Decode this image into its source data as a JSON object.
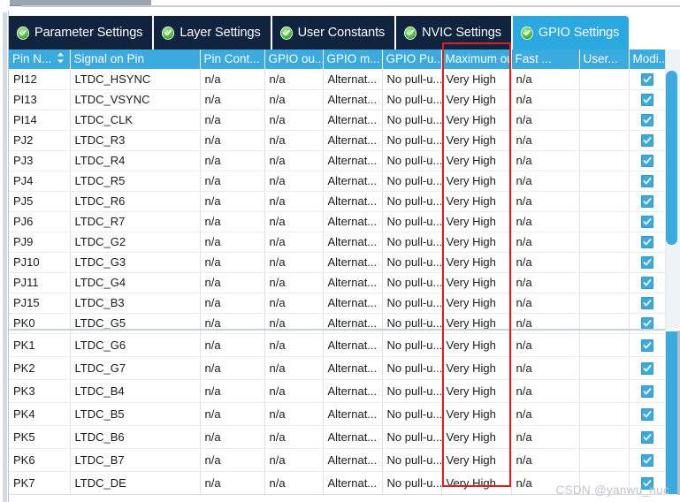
{
  "window": {
    "title": "GPIO Settings",
    "watermark": "CSDN @yanwu_nuc",
    "accent_color": "#29a9e0",
    "tab_inactive_color": "#10233f",
    "header_color": "#3babdf",
    "highlight_color": "#e21c1c"
  },
  "tabs": [
    {
      "label": "Parameter Settings",
      "icon": "green-check-icon",
      "active": false
    },
    {
      "label": "Layer Settings",
      "icon": "green-check-icon",
      "active": false
    },
    {
      "label": "User Constants",
      "icon": "green-check-icon",
      "active": false
    },
    {
      "label": "NVIC Settings",
      "icon": "green-check-icon",
      "active": false
    },
    {
      "label": "GPIO Settings",
      "icon": "green-check-icon",
      "active": true
    }
  ],
  "table": {
    "columns": [
      {
        "key": "pin_name",
        "label": "Pin N...",
        "sort_indicator": "↕",
        "sorted": true
      },
      {
        "key": "signal_on_pin",
        "label": "Signal on Pin",
        "align": "center"
      },
      {
        "key": "pin_context",
        "label": "Pin Cont..."
      },
      {
        "key": "gpio_output",
        "label": "GPIO ou..."
      },
      {
        "key": "gpio_mode",
        "label": "GPIO m..."
      },
      {
        "key": "gpio_pull",
        "label": "GPIO Pu..."
      },
      {
        "key": "max_output_speed",
        "label": "Maximum outp..."
      },
      {
        "key": "fast_mode",
        "label": "Fast ..."
      },
      {
        "key": "user_label",
        "label": "User..."
      },
      {
        "key": "modified",
        "label": "Modi..."
      }
    ],
    "rows": [
      {
        "pin_name": "PI12",
        "signal_on_pin": "LTDC_HSYNC",
        "pin_context": "n/a",
        "gpio_output": "n/a",
        "gpio_mode": "Alternat...",
        "gpio_pull": "No pull-u...",
        "max_output_speed": "Very High",
        "fast_mode": "n/a",
        "user_label": "",
        "modified": true
      },
      {
        "pin_name": "PI13",
        "signal_on_pin": "LTDC_VSYNC",
        "pin_context": "n/a",
        "gpio_output": "n/a",
        "gpio_mode": "Alternat...",
        "gpio_pull": "No pull-u...",
        "max_output_speed": "Very High",
        "fast_mode": "n/a",
        "user_label": "",
        "modified": true
      },
      {
        "pin_name": "PI14",
        "signal_on_pin": "LTDC_CLK",
        "pin_context": "n/a",
        "gpio_output": "n/a",
        "gpio_mode": "Alternat...",
        "gpio_pull": "No pull-u...",
        "max_output_speed": "Very High",
        "fast_mode": "n/a",
        "user_label": "",
        "modified": true
      },
      {
        "pin_name": "PJ2",
        "signal_on_pin": "LTDC_R3",
        "pin_context": "n/a",
        "gpio_output": "n/a",
        "gpio_mode": "Alternat...",
        "gpio_pull": "No pull-u...",
        "max_output_speed": "Very High",
        "fast_mode": "n/a",
        "user_label": "",
        "modified": true
      },
      {
        "pin_name": "PJ3",
        "signal_on_pin": "LTDC_R4",
        "pin_context": "n/a",
        "gpio_output": "n/a",
        "gpio_mode": "Alternat...",
        "gpio_pull": "No pull-u...",
        "max_output_speed": "Very High",
        "fast_mode": "n/a",
        "user_label": "",
        "modified": true
      },
      {
        "pin_name": "PJ4",
        "signal_on_pin": "LTDC_R5",
        "pin_context": "n/a",
        "gpio_output": "n/a",
        "gpio_mode": "Alternat...",
        "gpio_pull": "No pull-u...",
        "max_output_speed": "Very High",
        "fast_mode": "n/a",
        "user_label": "",
        "modified": true
      },
      {
        "pin_name": "PJ5",
        "signal_on_pin": "LTDC_R6",
        "pin_context": "n/a",
        "gpio_output": "n/a",
        "gpio_mode": "Alternat...",
        "gpio_pull": "No pull-u...",
        "max_output_speed": "Very High",
        "fast_mode": "n/a",
        "user_label": "",
        "modified": true
      },
      {
        "pin_name": "PJ6",
        "signal_on_pin": "LTDC_R7",
        "pin_context": "n/a",
        "gpio_output": "n/a",
        "gpio_mode": "Alternat...",
        "gpio_pull": "No pull-u...",
        "max_output_speed": "Very High",
        "fast_mode": "n/a",
        "user_label": "",
        "modified": true
      },
      {
        "pin_name": "PJ9",
        "signal_on_pin": "LTDC_G2",
        "pin_context": "n/a",
        "gpio_output": "n/a",
        "gpio_mode": "Alternat...",
        "gpio_pull": "No pull-u...",
        "max_output_speed": "Very High",
        "fast_mode": "n/a",
        "user_label": "",
        "modified": true
      },
      {
        "pin_name": "PJ10",
        "signal_on_pin": "LTDC_G3",
        "pin_context": "n/a",
        "gpio_output": "n/a",
        "gpio_mode": "Alternat...",
        "gpio_pull": "No pull-u...",
        "max_output_speed": "Very High",
        "fast_mode": "n/a",
        "user_label": "",
        "modified": true
      },
      {
        "pin_name": "PJ11",
        "signal_on_pin": "LTDC_G4",
        "pin_context": "n/a",
        "gpio_output": "n/a",
        "gpio_mode": "Alternat...",
        "gpio_pull": "No pull-u...",
        "max_output_speed": "Very High",
        "fast_mode": "n/a",
        "user_label": "",
        "modified": true
      },
      {
        "pin_name": "PJ15",
        "signal_on_pin": "LTDC_B3",
        "pin_context": "n/a",
        "gpio_output": "n/a",
        "gpio_mode": "Alternat...",
        "gpio_pull": "No pull-u...",
        "max_output_speed": "Very High",
        "fast_mode": "n/a",
        "user_label": "",
        "modified": true
      },
      {
        "pin_name": "PK0",
        "signal_on_pin": "LTDC_G5",
        "pin_context": "n/a",
        "gpio_output": "n/a",
        "gpio_mode": "Alternat...",
        "gpio_pull": "No pull-u...",
        "max_output_speed": "Very High",
        "fast_mode": "n/a",
        "user_label": "",
        "modified": true
      },
      {
        "pin_name": "PK1",
        "signal_on_pin": "LTDC_G6",
        "pin_context": "n/a",
        "gpio_output": "n/a",
        "gpio_mode": "Alternat...",
        "gpio_pull": "No pull-u...",
        "max_output_speed": "Very High",
        "fast_mode": "n/a",
        "user_label": "",
        "modified": true
      },
      {
        "pin_name": "PK2",
        "signal_on_pin": "LTDC_G7",
        "pin_context": "n/a",
        "gpio_output": "n/a",
        "gpio_mode": "Alternat...",
        "gpio_pull": "No pull-u...",
        "max_output_speed": "Very High",
        "fast_mode": "n/a",
        "user_label": "",
        "modified": true
      },
      {
        "pin_name": "PK3",
        "signal_on_pin": "LTDC_B4",
        "pin_context": "n/a",
        "gpio_output": "n/a",
        "gpio_mode": "Alternat...",
        "gpio_pull": "No pull-u...",
        "max_output_speed": "Very High",
        "fast_mode": "n/a",
        "user_label": "",
        "modified": true
      },
      {
        "pin_name": "PK4",
        "signal_on_pin": "LTDC_B5",
        "pin_context": "n/a",
        "gpio_output": "n/a",
        "gpio_mode": "Alternat...",
        "gpio_pull": "No pull-u...",
        "max_output_speed": "Very High",
        "fast_mode": "n/a",
        "user_label": "",
        "modified": true
      },
      {
        "pin_name": "PK5",
        "signal_on_pin": "LTDC_B6",
        "pin_context": "n/a",
        "gpio_output": "n/a",
        "gpio_mode": "Alternat...",
        "gpio_pull": "No pull-u...",
        "max_output_speed": "Very High",
        "fast_mode": "n/a",
        "user_label": "",
        "modified": true
      },
      {
        "pin_name": "PK6",
        "signal_on_pin": "LTDC_B7",
        "pin_context": "n/a",
        "gpio_output": "n/a",
        "gpio_mode": "Alternat...",
        "gpio_pull": "No pull-u...",
        "max_output_speed": "Very High",
        "fast_mode": "n/a",
        "user_label": "",
        "modified": true
      },
      {
        "pin_name": "PK7",
        "signal_on_pin": "LTDC_DE",
        "pin_context": "n/a",
        "gpio_output": "n/a",
        "gpio_mode": "Alternat...",
        "gpio_pull": "No pull-u...",
        "max_output_speed": "Very High",
        "fast_mode": "n/a",
        "user_label": "",
        "modified": true
      }
    ],
    "tight_row_count": 13
  }
}
